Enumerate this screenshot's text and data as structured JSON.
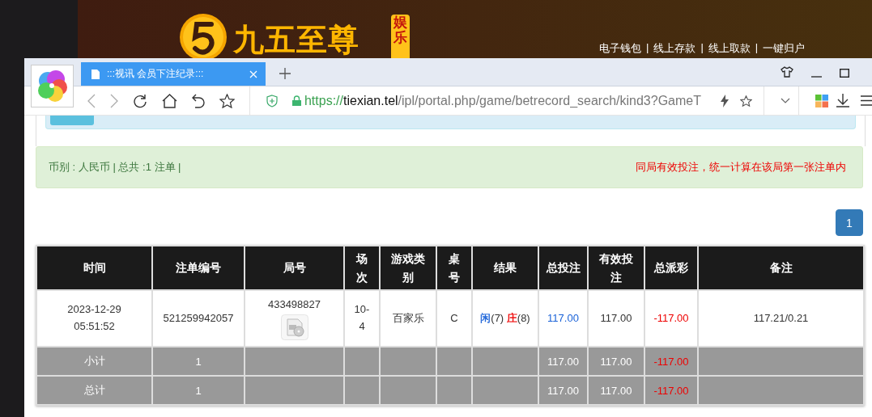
{
  "banner": {
    "logo_text": "九五至尊",
    "logo_badge": "娱乐",
    "links": [
      "电子钱包",
      "线上存款",
      "线上取款",
      "一键归户"
    ],
    "separator": "|"
  },
  "browser": {
    "tabs": [
      {
        "title": ":::视讯 会员下注纪录:::",
        "selected": true
      }
    ],
    "url": {
      "scheme": "https://",
      "host": "tiexian.tel",
      "path": "/ipl/portal.php/game/betrecord_search/kind3?GameT"
    }
  },
  "summary": {
    "left": "币别 : 人民币 | 总共 :1 注单 |",
    "notice": "同局有效投注，统一计算在该局第一张注单内"
  },
  "pagination": [
    {
      "label": "1",
      "selected": true
    }
  ],
  "table": {
    "columns": [
      "时间",
      "注单编号",
      "局号",
      "场次",
      "游戏类别",
      "桌号",
      "结果",
      "总投注",
      "有效投注",
      "总派彩",
      "备注"
    ],
    "rows": [
      {
        "kind": "bet",
        "cells": [
          {
            "text": "2023-12-29 05:51:52"
          },
          {
            "text": "521259942057"
          },
          {
            "text": "433498827",
            "video": true
          },
          {
            "text": "10-4"
          },
          {
            "text": "百家乐"
          },
          {
            "text": "C"
          },
          {
            "parts": [
              {
                "text": "闲",
                "color": "#1a62d8"
              },
              {
                "text": "(7) "
              },
              {
                "text": "庄",
                "color": "#ee0000"
              },
              {
                "text": "(8)"
              }
            ]
          },
          {
            "text": "117.00",
            "color": "#1a62d8"
          },
          {
            "text": "117.00"
          },
          {
            "text": "-117.00",
            "color": "#ee0000"
          },
          {
            "text": "117.21/0.21"
          }
        ]
      },
      {
        "kind": "subtotal",
        "cells": [
          {
            "text": "小计"
          },
          {
            "text": "1"
          },
          {},
          {},
          {},
          {},
          {},
          {
            "text": "117.00"
          },
          {
            "text": "117.00"
          },
          {
            "text": "-117.00",
            "color": "#ee0000"
          },
          {}
        ]
      },
      {
        "kind": "total",
        "cells": [
          {
            "text": "总计"
          },
          {
            "text": "1"
          },
          {},
          {},
          {},
          {},
          {},
          {
            "text": "117.00"
          },
          {
            "text": "117.00"
          },
          {
            "text": "-117.00",
            "color": "#ee0000"
          },
          {}
        ]
      }
    ]
  }
}
